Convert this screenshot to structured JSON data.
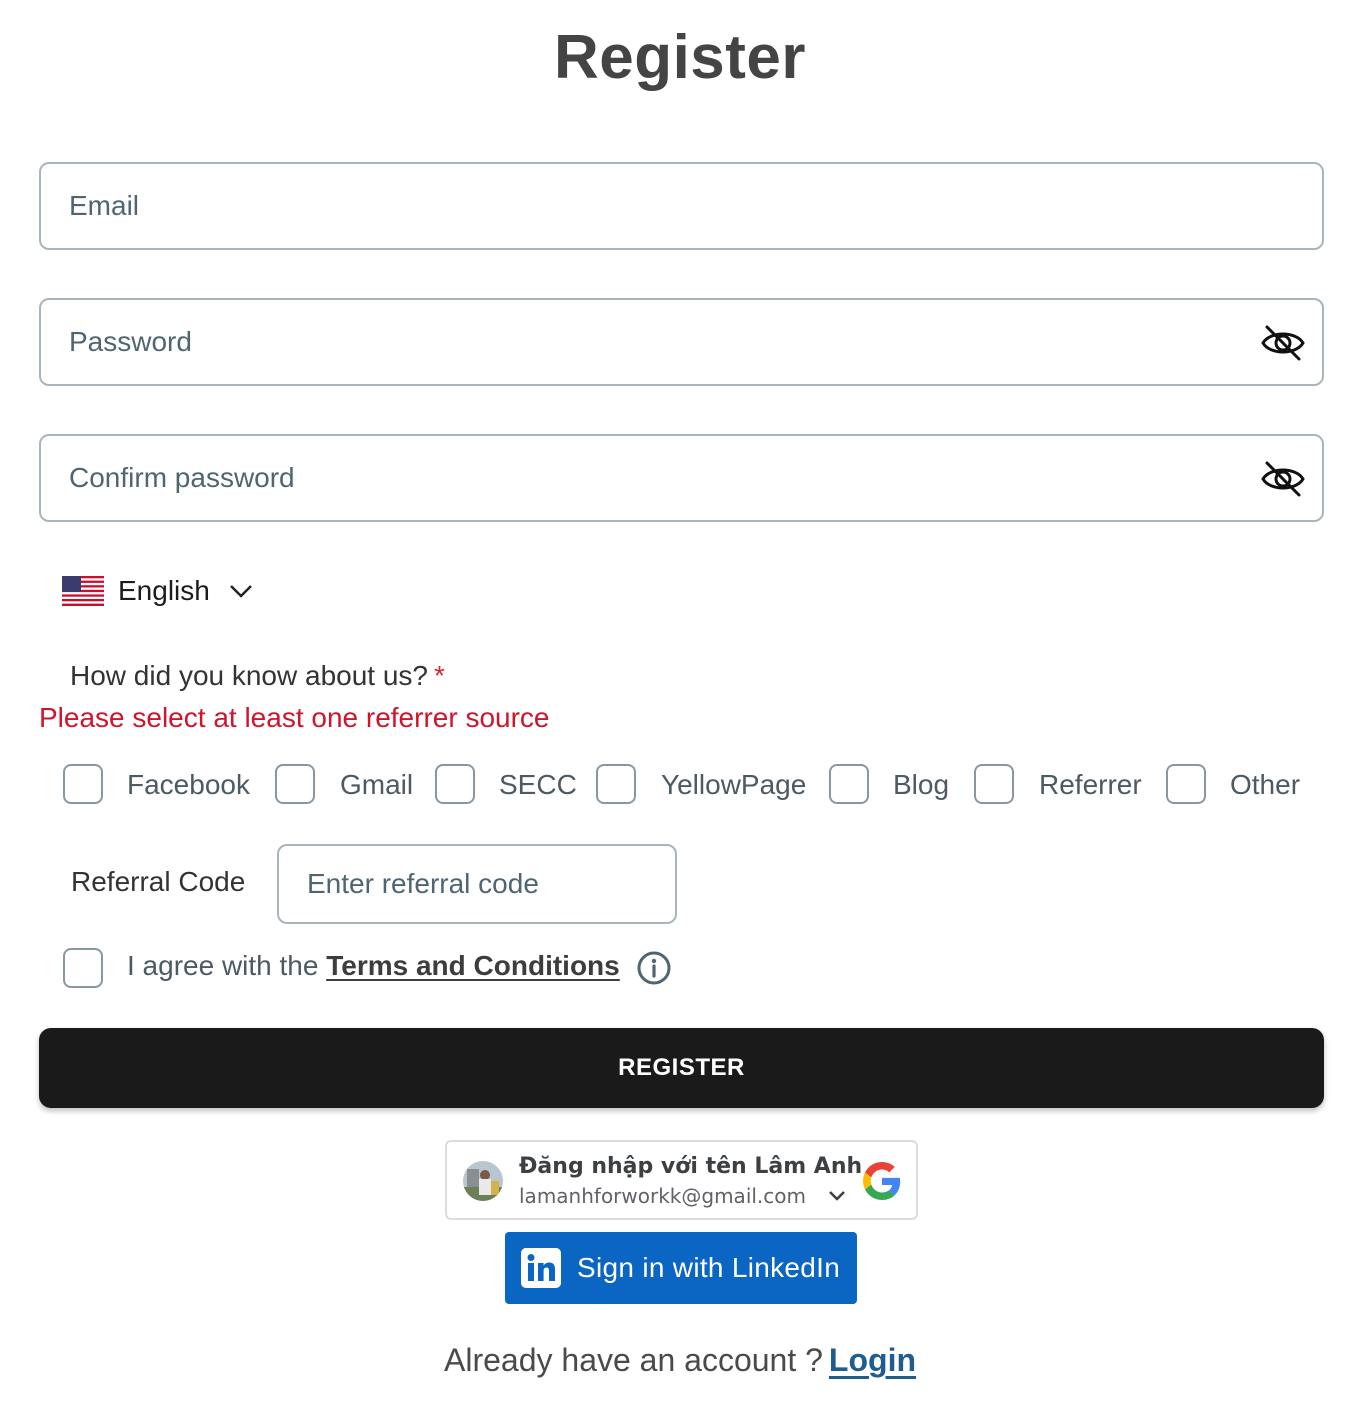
{
  "page": {
    "title": "Register"
  },
  "form": {
    "email": {
      "value": "",
      "placeholder": "Email"
    },
    "password": {
      "value": "",
      "placeholder": "Password",
      "toggle_icon": "eye-slash-icon"
    },
    "confirm_password": {
      "value": "",
      "placeholder": "Confirm password",
      "toggle_icon": "eye-slash-icon"
    }
  },
  "language": {
    "selected": "English",
    "flag_icon": "us-flag-icon",
    "dropdown_icon": "chevron-down-icon"
  },
  "referrer": {
    "question": "How did you know about us?",
    "required_mark": "*",
    "error": "Please select at least one referrer source",
    "options": [
      {
        "label": "Facebook",
        "checked": false
      },
      {
        "label": "Gmail",
        "checked": false
      },
      {
        "label": "SECC",
        "checked": false
      },
      {
        "label": "YellowPage",
        "checked": false
      },
      {
        "label": "Blog",
        "checked": false
      },
      {
        "label": "Referrer",
        "checked": false
      },
      {
        "label": "Other",
        "checked": false
      }
    ]
  },
  "referral_code": {
    "label": "Referral Code",
    "placeholder": "Enter referral code",
    "value": ""
  },
  "terms": {
    "prefix": "I agree with the ",
    "link": "Terms and Conditions",
    "checked": false,
    "info_icon": "info-icon"
  },
  "register_button": {
    "label": "REGISTER"
  },
  "google_signin": {
    "name": "Đăng nhập với tên Lâm Anh",
    "email": "lamanhforworkk@gmail.com",
    "icon": "google-icon"
  },
  "linkedin_signin": {
    "label": "Sign in with LinkedIn",
    "icon": "linkedin-icon"
  },
  "footer": {
    "text": "Already have an account ?",
    "link": "Login"
  },
  "colors": {
    "error": "#d0142c",
    "primary_button": "#1a1a1a",
    "linkedin": "#0a66c2",
    "link": "#1f5c8f"
  }
}
